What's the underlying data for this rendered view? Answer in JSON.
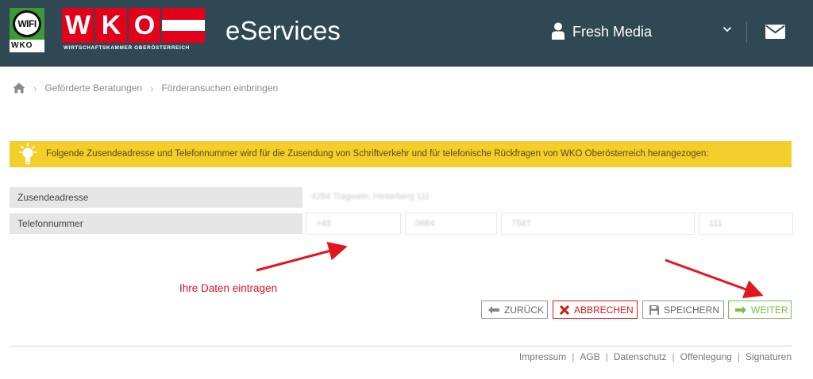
{
  "header": {
    "wifi_logo": {
      "circle_text": "WIFI",
      "bottom_text": "WKO"
    },
    "wko_logo": {
      "letters": [
        "W",
        "K",
        "O"
      ],
      "subtitle": "WIRTSCHAFTSKAMMER OBERÖSTERREICH"
    },
    "app_title": "eServices",
    "user_icon": "user-icon",
    "user_name": "Fresh Media",
    "dropdown_icon": "chevron-down-icon",
    "mail_icon": "envelope-icon",
    "bg_color": "#2f4853"
  },
  "breadcrumb": {
    "home_icon": "home-icon",
    "items": [
      "Geförderte Beratungen",
      "Förderansuchen einbringen"
    ],
    "separator": "›"
  },
  "info": {
    "icon": "lightbulb-icon",
    "text": "Folgende Zusendeadresse und Telefonnummer wird für die Zusendung von Schriftverkehr und für telefonische Rückfragen von WKO Oberösterreich herangezogen:",
    "bg_color": "#f4ce2a"
  },
  "form": {
    "address": {
      "label": "Zusendeadresse",
      "value": "4284 Tragwein, Hinterberg 111"
    },
    "phone": {
      "label": "Telefonnummer",
      "fields": [
        "+43",
        "0664",
        "7547",
        "111"
      ]
    }
  },
  "annotation": {
    "text": "Ihre Daten eintragen",
    "color": "#d8161b"
  },
  "buttons": {
    "back": {
      "label": "ZURÜCK",
      "icon": "arrow-left-icon"
    },
    "cancel": {
      "label": "ABBRECHEN",
      "icon": "close-icon",
      "color": "#d8161b"
    },
    "save": {
      "label": "SPEICHERN",
      "icon": "floppy-disk-icon"
    },
    "next": {
      "label": "WEITER",
      "icon": "arrow-right-icon",
      "color": "#7ac043"
    }
  },
  "footer": {
    "links": [
      "Impressum",
      "AGB",
      "Datenschutz",
      "Offenlegung",
      "Signaturen"
    ],
    "separator": "|"
  }
}
